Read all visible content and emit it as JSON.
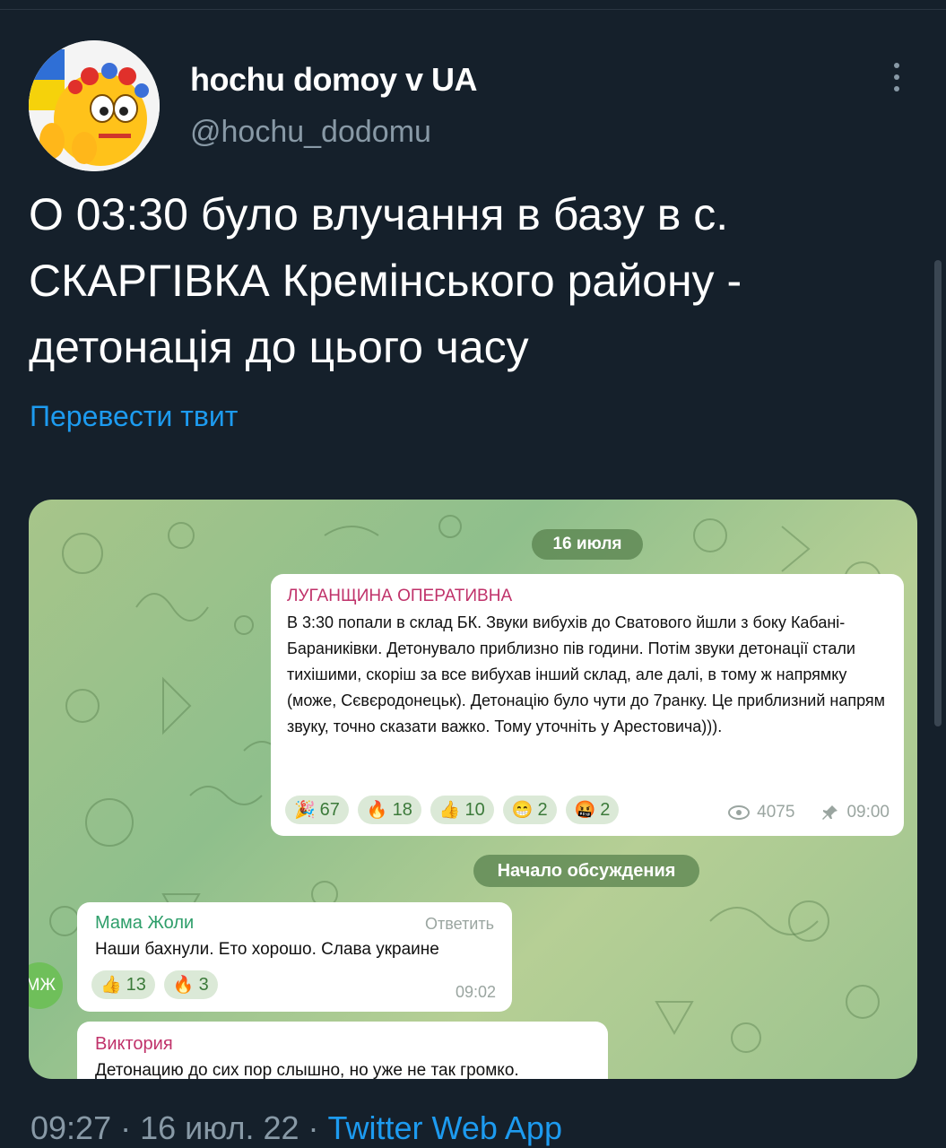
{
  "tweet": {
    "display_name": "hochu domoy v UA",
    "handle": "@hochu_dodomu",
    "text": "О 03:30 було влучання в базу в с. СКАРГІВКА Кремінського району - детонація до цього часу",
    "translate_label": "Перевести твит",
    "footer": {
      "time": "09:27",
      "sep1": " · ",
      "date": "16 июл. 22",
      "sep2": " · ",
      "app": "Twitter Web App"
    }
  },
  "telegram": {
    "date_pill": "16 июля",
    "post": {
      "sender": "ЛУГАНЩИНА ОПЕРАТИВНА",
      "text": "В 3:30 попали в склад БК. Звуки вибухів до Сватового йшли з боку Кабані-Бараниківки. Детонувало приблизно пів години. Потім звуки детонації стали тихішими, скоріш за все вибухав інший склад, але далі, в тому ж напрямку (може, Сєвєродонецьк). Детонацію було чути до 7ранку. Це приблизний напрям звуку, точно сказати важко. Тому уточніть у Арестовича))).",
      "reactions": [
        {
          "emoji": "🎉",
          "count": "67"
        },
        {
          "emoji": "🔥",
          "count": "18"
        },
        {
          "emoji": "👍",
          "count": "10"
        },
        {
          "emoji": "😁",
          "count": "2"
        },
        {
          "emoji": "🤬",
          "count": "2"
        }
      ],
      "views": "4075",
      "time": "09:00"
    },
    "discussion_pill": "Начало обсуждения",
    "comment1": {
      "sender": "Мама Жоли",
      "reply_label": "Ответить",
      "text": "Наши бахнули. Ето хорошо. Слава украине",
      "reactions": [
        {
          "emoji": "👍",
          "count": "13"
        },
        {
          "emoji": "🔥",
          "count": "3"
        }
      ],
      "time": "09:02",
      "avatar_initials": "МЖ"
    },
    "comment2": {
      "sender": "Виктория",
      "text": "Детонацию до сих пор слышно, но уже не так громко."
    }
  },
  "icons": {
    "more": "more-vertical-icon",
    "views": "eye-icon",
    "pinned": "pin-icon"
  },
  "colors": {
    "background": "#15202b",
    "link": "#1d9bf0",
    "secondary_text": "#8899a6"
  }
}
